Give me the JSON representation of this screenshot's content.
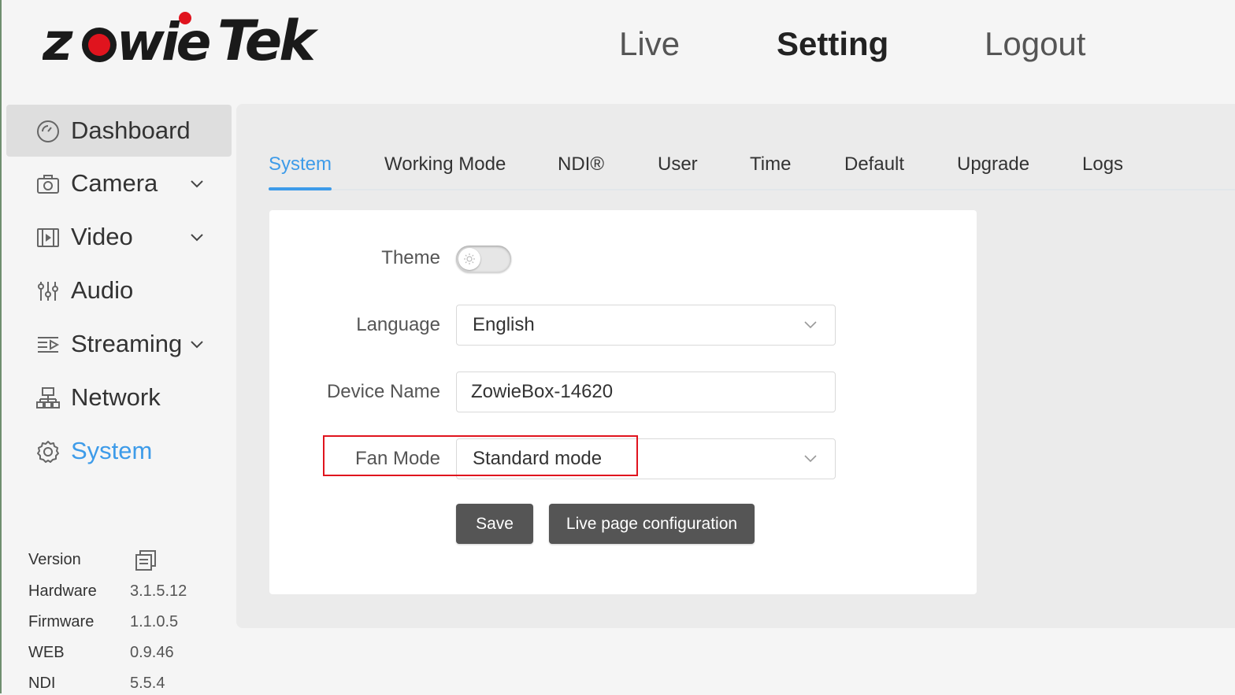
{
  "brand": {
    "logo_text": "zowieTek",
    "accent_color": "#e0141e"
  },
  "topnav": [
    {
      "label": "Live"
    },
    {
      "label": "Setting"
    },
    {
      "label": "Logout"
    }
  ],
  "sidebar": {
    "items": [
      {
        "label": "Dashboard",
        "icon": "gauge-icon"
      },
      {
        "label": "Camera",
        "icon": "camera-icon"
      },
      {
        "label": "Video",
        "icon": "film-icon"
      },
      {
        "label": "Audio",
        "icon": "mixer-sliders-icon"
      },
      {
        "label": "Streaming",
        "icon": "stream-icon"
      },
      {
        "label": "Network",
        "icon": "network-icon"
      },
      {
        "label": "System",
        "icon": "gear-icon"
      }
    ],
    "selected_color": "#3d9be9",
    "version": {
      "header": "Version",
      "rows": [
        {
          "label": "Hardware",
          "value": "3.1.5.12"
        },
        {
          "label": "Firmware",
          "value": "1.1.0.5"
        },
        {
          "label": "WEB",
          "value": "0.9.46"
        },
        {
          "label": "NDI",
          "value": "5.5.4"
        }
      ]
    }
  },
  "tabs": [
    {
      "label": "System"
    },
    {
      "label": "Working Mode"
    },
    {
      "label": "NDI®"
    },
    {
      "label": "User"
    },
    {
      "label": "Time"
    },
    {
      "label": "Default"
    },
    {
      "label": "Upgrade"
    },
    {
      "label": "Logs"
    }
  ],
  "form": {
    "theme_label": "Theme",
    "language_label": "Language",
    "language_value": "English",
    "device_name_label": "Device Name",
    "device_name_value": "ZowieBox-14620",
    "fan_mode_label": "Fan Mode",
    "fan_mode_value": "Standard mode",
    "save_label": "Save",
    "live_config_label": "Live page configuration"
  }
}
